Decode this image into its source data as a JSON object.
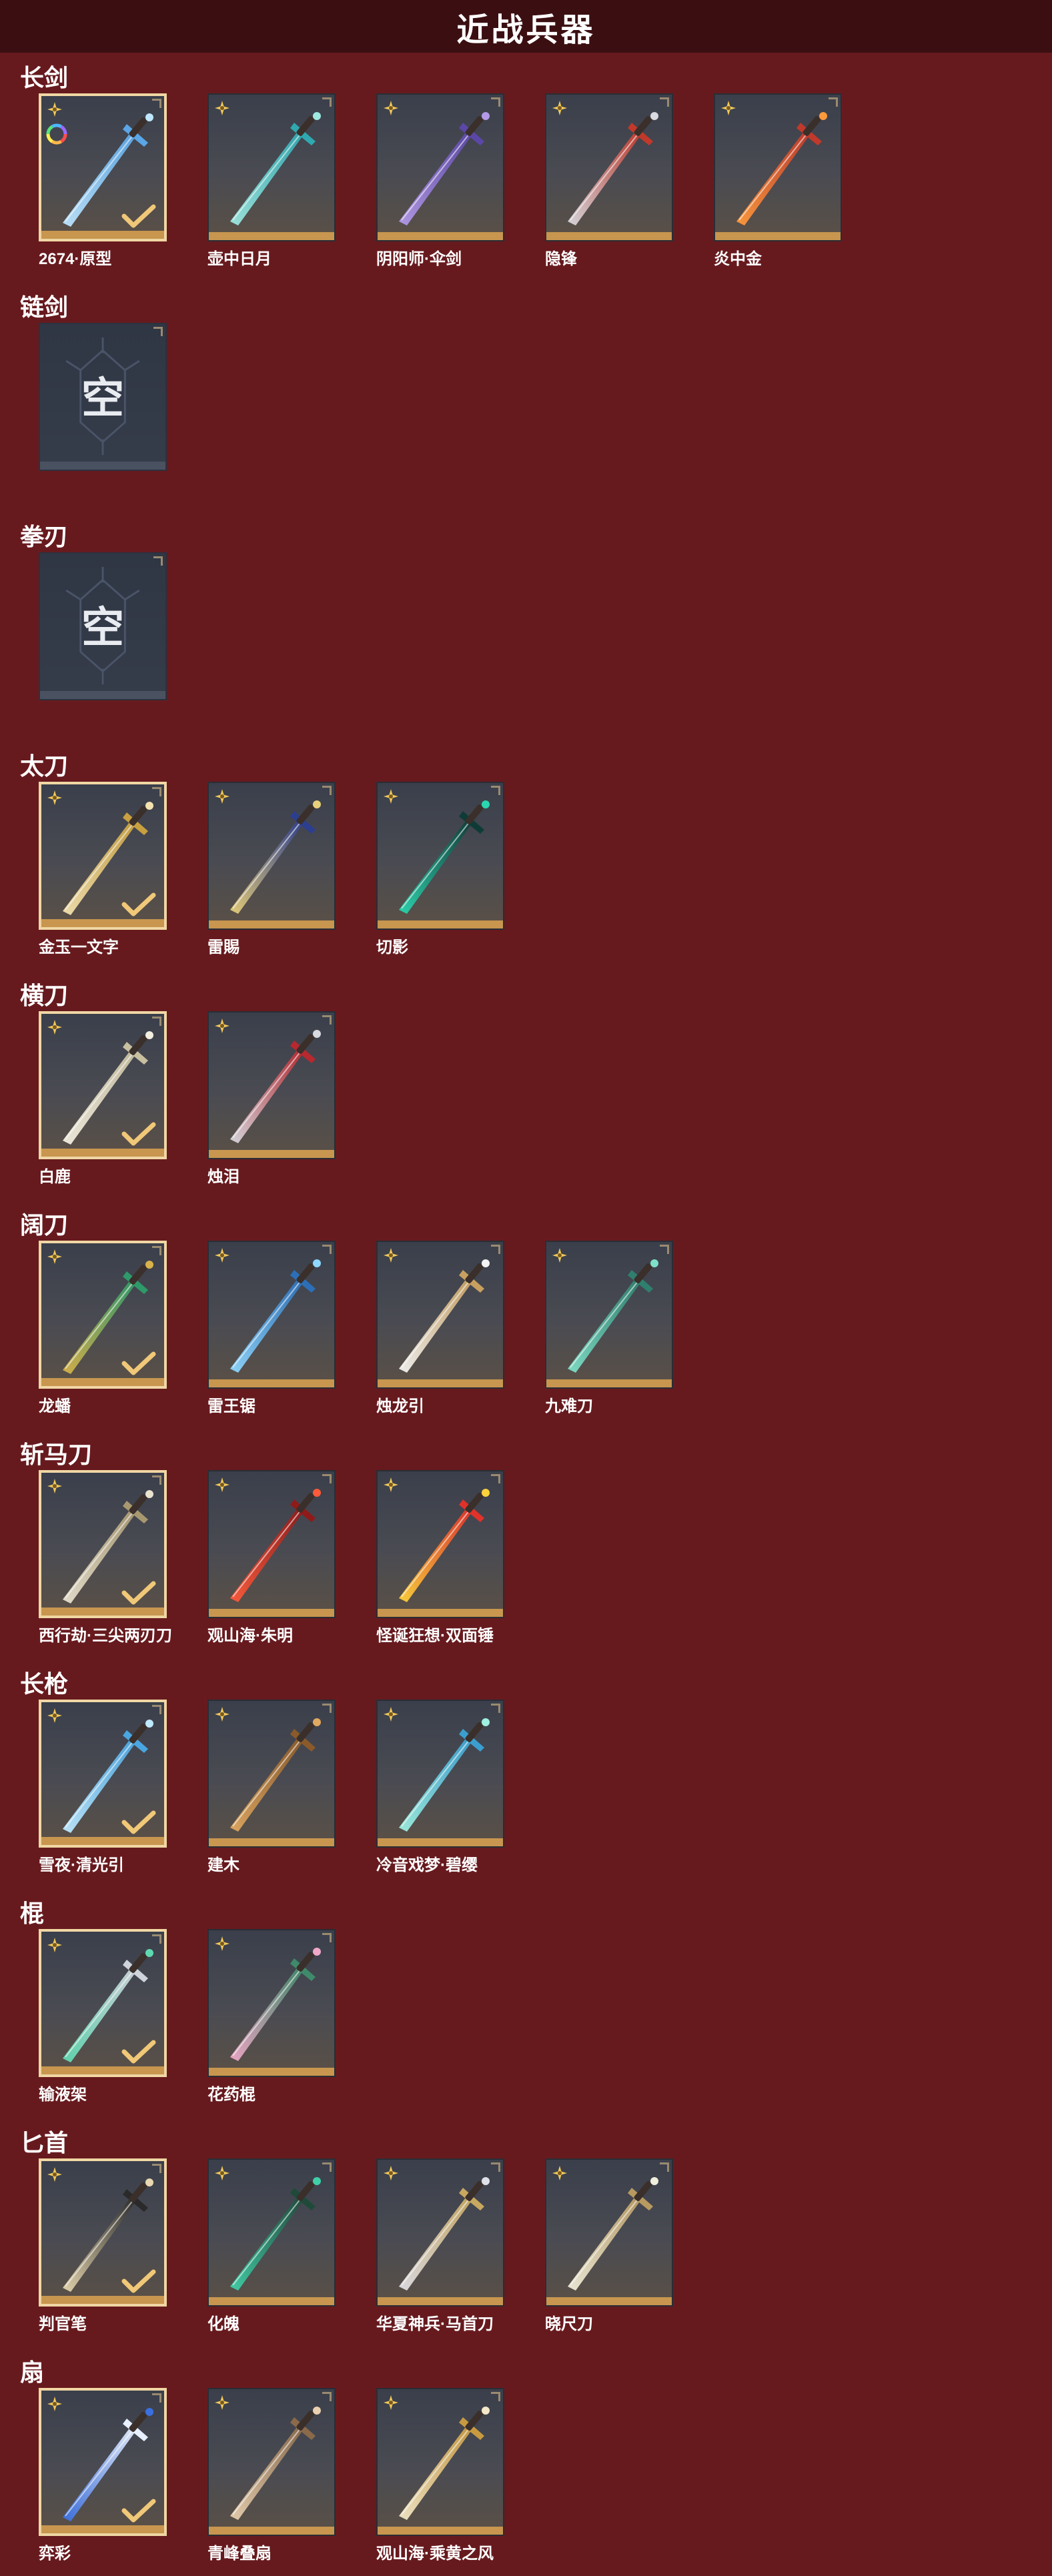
{
  "header": {
    "title": "近战兵器"
  },
  "colors": {
    "background": "#671a1e",
    "header_bg": "#3b0f12",
    "equipped_border": "#f0d7a4",
    "rarity_strip": "#c8964f"
  },
  "categories": [
    {
      "label": "长剑",
      "items": [
        {
          "name": "2674·原型",
          "equipped": true,
          "ring": true,
          "icon": "glowing-sword-icon",
          "colors": [
            "#bfe6ff",
            "#5aa6e6"
          ]
        },
        {
          "name": "壶中日月",
          "equipped": false,
          "icon": "jade-sword-icon",
          "colors": [
            "#9fe8e0",
            "#2fa8b0"
          ]
        },
        {
          "name": "阴阳师·伞剑",
          "equipped": false,
          "icon": "umbrella-sword-icon",
          "colors": [
            "#b49ae8",
            "#5b47a8"
          ]
        },
        {
          "name": "隐锋",
          "equipped": false,
          "icon": "red-hilt-sword-icon",
          "colors": [
            "#d9d9e0",
            "#c0392b"
          ]
        },
        {
          "name": "炎中金",
          "equipped": false,
          "icon": "flame-sword-icon",
          "colors": [
            "#ff9a3c",
            "#c0392b"
          ]
        }
      ]
    },
    {
      "label": "链剑",
      "empty": true,
      "empty_text": "空"
    },
    {
      "label": "拳刃",
      "empty": true,
      "empty_text": "空"
    },
    {
      "label": "太刀",
      "items": [
        {
          "name": "金玉一文字",
          "equipped": true,
          "icon": "gold-katana-icon",
          "colors": [
            "#f3e2b0",
            "#c9a040"
          ]
        },
        {
          "name": "雷賜",
          "equipped": false,
          "icon": "thunder-katana-icon",
          "colors": [
            "#e8d07a",
            "#2c3e8f"
          ]
        },
        {
          "name": "切影",
          "equipped": false,
          "icon": "shadow-katana-icon",
          "colors": [
            "#2ad6b0",
            "#0f3b36"
          ]
        }
      ]
    },
    {
      "label": "横刀",
      "items": [
        {
          "name": "白鹿",
          "equipped": true,
          "icon": "white-blade-icon",
          "colors": [
            "#f2eee0",
            "#c8bfa0"
          ]
        },
        {
          "name": "烛泪",
          "equipped": false,
          "icon": "crimson-blade-icon",
          "colors": [
            "#d9d9e0",
            "#b7282f"
          ]
        }
      ]
    },
    {
      "label": "阔刀",
      "items": [
        {
          "name": "龙蟠",
          "equipped": true,
          "icon": "dragon-broadsword-icon",
          "colors": [
            "#d8b24a",
            "#2e9a6a"
          ]
        },
        {
          "name": "雷王锯",
          "equipped": false,
          "icon": "thunder-saw-icon",
          "colors": [
            "#8fd8ff",
            "#2c6fb8"
          ]
        },
        {
          "name": "烛龙引",
          "equipped": false,
          "icon": "white-dragon-blade-icon",
          "colors": [
            "#f4f4f4",
            "#c8a060"
          ]
        },
        {
          "name": "九难刀",
          "equipped": false,
          "icon": "jade-broadsword-icon",
          "colors": [
            "#7fe0c8",
            "#2f7f6e"
          ]
        }
      ]
    },
    {
      "label": "斩马刀",
      "items": [
        {
          "name": "西行劫·三尖两刃刀",
          "equipped": true,
          "icon": "trident-blade-icon",
          "colors": [
            "#e8e2d0",
            "#a89870"
          ]
        },
        {
          "name": "观山海·朱明",
          "equipped": false,
          "icon": "fire-glaive-icon",
          "colors": [
            "#ff5a3a",
            "#8f1a1a"
          ]
        },
        {
          "name": "怪诞狂想·双面锤",
          "equipped": false,
          "icon": "clown-hammer-icon",
          "colors": [
            "#ffd23a",
            "#e0322a"
          ]
        }
      ]
    },
    {
      "label": "长枪",
      "items": [
        {
          "name": "雪夜·清光引",
          "equipped": true,
          "icon": "ice-spear-icon",
          "colors": [
            "#bfe9ff",
            "#4aa6e0"
          ]
        },
        {
          "name": "建木",
          "equipped": false,
          "icon": "wood-spear-icon",
          "colors": [
            "#e0a860",
            "#8a5a2a"
          ]
        },
        {
          "name": "冷音戏梦·碧缨",
          "equipped": false,
          "icon": "jade-tassel-spear-icon",
          "colors": [
            "#9ff0e0",
            "#3a9fd0"
          ]
        }
      ]
    },
    {
      "label": "棍",
      "items": [
        {
          "name": "输液架",
          "equipped": true,
          "icon": "iv-stand-icon",
          "colors": [
            "#5fd8b0",
            "#cfd4dc"
          ]
        },
        {
          "name": "花药棍",
          "equipped": false,
          "icon": "flower-staff-icon",
          "colors": [
            "#f0a8c8",
            "#3f8a6a"
          ]
        }
      ]
    },
    {
      "label": "匕首",
      "items": [
        {
          "name": "判官笔",
          "equipped": true,
          "icon": "brush-dagger-icon",
          "colors": [
            "#e8d8b0",
            "#2a2a2a"
          ]
        },
        {
          "name": "化魄",
          "equipped": false,
          "icon": "serpent-dagger-icon",
          "colors": [
            "#3fd0a8",
            "#1f4a3a"
          ]
        },
        {
          "name": "华夏神兵·马首刀",
          "equipped": false,
          "icon": "horsehead-knife-icon",
          "colors": [
            "#e0e0e8",
            "#c8a860"
          ]
        },
        {
          "name": "晓尺刀",
          "equipped": false,
          "icon": "dawn-dagger-icon",
          "colors": [
            "#f0eedc",
            "#b89a60"
          ]
        }
      ]
    },
    {
      "label": "扇",
      "items": [
        {
          "name": "弈彩",
          "equipped": true,
          "icon": "blue-fan-icon",
          "colors": [
            "#3a6fe0",
            "#e8f0ff"
          ]
        },
        {
          "name": "青峰叠扇",
          "equipped": false,
          "icon": "folding-fan-icon",
          "colors": [
            "#e8d0b0",
            "#8a6a4a"
          ]
        },
        {
          "name": "观山海·乘黄之风",
          "equipped": false,
          "icon": "golden-fan-icon",
          "colors": [
            "#f4e8c8",
            "#c89a40"
          ]
        }
      ]
    }
  ]
}
